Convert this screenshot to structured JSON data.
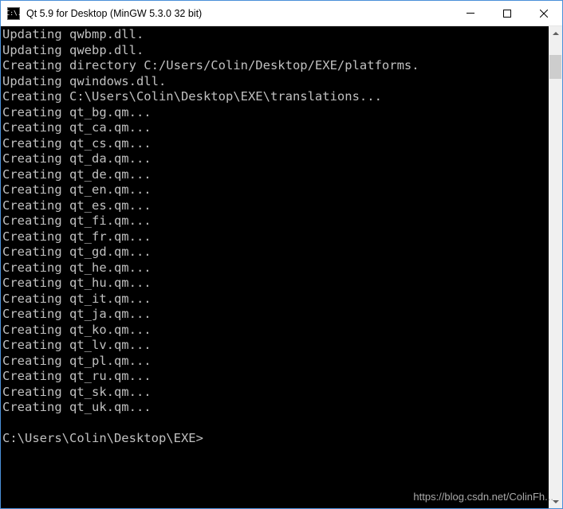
{
  "window": {
    "title": "Qt 5.9 for Desktop (MinGW 5.3.0 32 bit)",
    "icon_label": "C:\\."
  },
  "terminal": {
    "lines": [
      "Updating qwbmp.dll.",
      "Updating qwebp.dll.",
      "Creating directory C:/Users/Colin/Desktop/EXE/platforms.",
      "Updating qwindows.dll.",
      "Creating C:\\Users\\Colin\\Desktop\\EXE\\translations...",
      "Creating qt_bg.qm...",
      "Creating qt_ca.qm...",
      "Creating qt_cs.qm...",
      "Creating qt_da.qm...",
      "Creating qt_de.qm...",
      "Creating qt_en.qm...",
      "Creating qt_es.qm...",
      "Creating qt_fi.qm...",
      "Creating qt_fr.qm...",
      "Creating qt_gd.qm...",
      "Creating qt_he.qm...",
      "Creating qt_hu.qm...",
      "Creating qt_it.qm...",
      "Creating qt_ja.qm...",
      "Creating qt_ko.qm...",
      "Creating qt_lv.qm...",
      "Creating qt_pl.qm...",
      "Creating qt_ru.qm...",
      "Creating qt_sk.qm...",
      "Creating qt_uk.qm..."
    ],
    "prompt": "C:\\Users\\Colin\\Desktop\\EXE>"
  },
  "watermark": "https://blog.csdn.net/ColinFh..."
}
